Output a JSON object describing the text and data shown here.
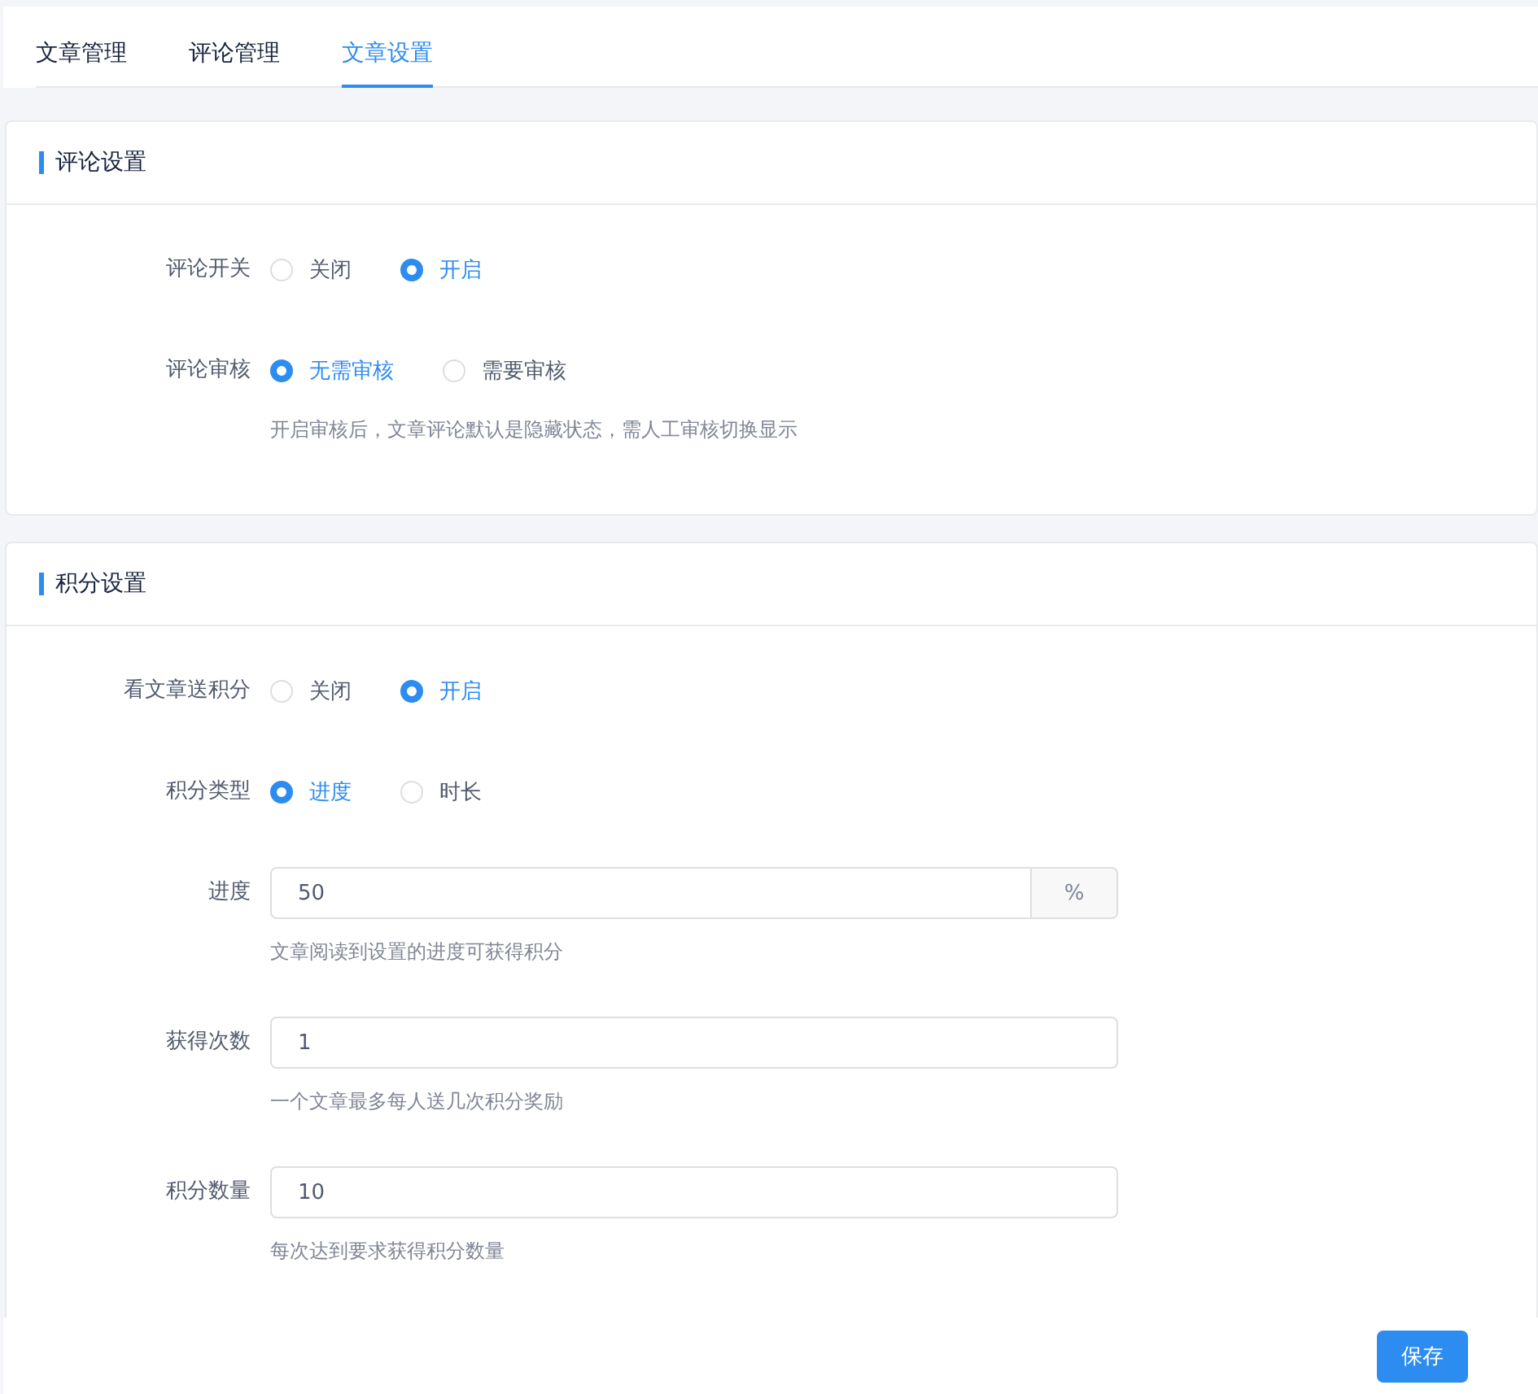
{
  "tabs": [
    {
      "label": "文章管理",
      "selected": false
    },
    {
      "label": "评论管理",
      "selected": false
    },
    {
      "label": "文章设置",
      "selected": true
    }
  ],
  "sections": [
    {
      "title": "评论设置",
      "fields": [
        {
          "kind": "radio",
          "label": "评论开关",
          "options": [
            {
              "label": "关闭",
              "selected": false
            },
            {
              "label": "开启",
              "selected": true
            }
          ]
        },
        {
          "kind": "radio",
          "label": "评论审核",
          "options": [
            {
              "label": "无需审核",
              "selected": true
            },
            {
              "label": "需要审核",
              "selected": false
            }
          ],
          "hint": "开启审核后，文章评论默认是隐藏状态，需人工审核切换显示"
        }
      ]
    },
    {
      "title": "积分设置",
      "fields": [
        {
          "kind": "radio",
          "label": "看文章送积分",
          "options": [
            {
              "label": "关闭",
              "selected": false
            },
            {
              "label": "开启",
              "selected": true
            }
          ]
        },
        {
          "kind": "radio",
          "label": "积分类型",
          "options": [
            {
              "label": "进度",
              "selected": true
            },
            {
              "label": "时长",
              "selected": false
            }
          ]
        },
        {
          "kind": "input",
          "label": "进度",
          "value": "50",
          "suffix": "%",
          "hint": "文章阅读到设置的进度可获得积分"
        },
        {
          "kind": "input",
          "label": "获得次数",
          "value": "1",
          "hint": "一个文章最多每人送几次积分奖励"
        },
        {
          "kind": "input",
          "label": "积分数量",
          "value": "10",
          "hint": "每次达到要求获得积分数量"
        }
      ]
    }
  ],
  "save_button": "保存"
}
